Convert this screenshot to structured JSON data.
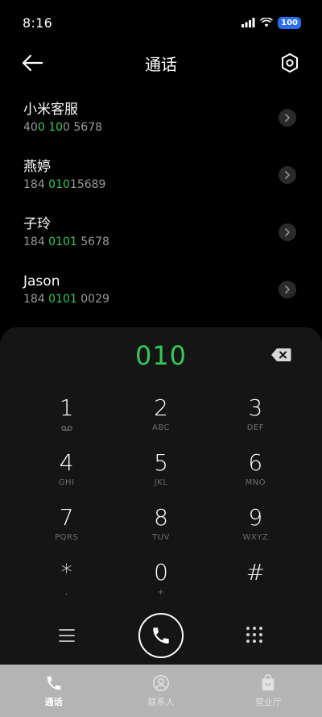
{
  "status_bar": {
    "time": "8:16",
    "battery": "100"
  },
  "header": {
    "title": "通话"
  },
  "contacts": [
    {
      "name": "小米客服",
      "number_parts": [
        "40",
        "0",
        " ",
        "10",
        "0 5678"
      ]
    },
    {
      "name": "燕婷",
      "number_parts": [
        "184 ",
        "010",
        "15689"
      ]
    },
    {
      "name": "子玲",
      "number_parts": [
        "184 ",
        "0101",
        " 5678"
      ]
    },
    {
      "name": "Jason",
      "number_parts": [
        "184 ",
        "0101",
        " 0029"
      ]
    }
  ],
  "dialer": {
    "input": "010",
    "keys": [
      {
        "digit": "1",
        "letters": ""
      },
      {
        "digit": "2",
        "letters": "ABC"
      },
      {
        "digit": "3",
        "letters": "DEF"
      },
      {
        "digit": "4",
        "letters": "GHI"
      },
      {
        "digit": "5",
        "letters": "JKL"
      },
      {
        "digit": "6",
        "letters": "MNO"
      },
      {
        "digit": "7",
        "letters": "PQRS"
      },
      {
        "digit": "8",
        "letters": "TUV"
      },
      {
        "digit": "9",
        "letters": "WXYZ"
      },
      {
        "digit": "*",
        "letters": ","
      },
      {
        "digit": "0",
        "letters": "+"
      },
      {
        "digit": "#",
        "letters": ""
      }
    ]
  },
  "bottom_nav": [
    {
      "label": "通话",
      "icon": "phone-icon",
      "active": true
    },
    {
      "label": "联系人",
      "icon": "contacts-icon",
      "active": false
    },
    {
      "label": "营业厅",
      "icon": "store-icon",
      "active": false
    }
  ],
  "colors": {
    "accent": "#35c759",
    "background": "#000000",
    "dialer_bg": "#151515",
    "nav_bg": "#b4b4b4"
  }
}
